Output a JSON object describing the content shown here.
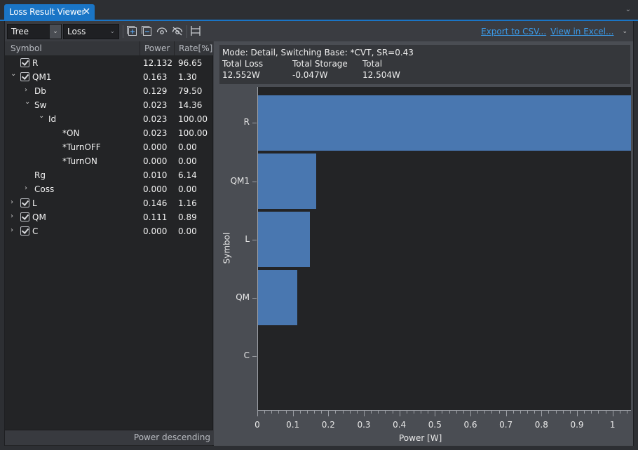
{
  "tab": {
    "title": "Loss Result Viewer",
    "close_glyph": "✕"
  },
  "toolbar": {
    "view_select": "Tree",
    "type_select": "Loss",
    "icons": [
      "expand-all-icon",
      "collapse-all-icon",
      "show-icon",
      "hide-icon",
      "fit-columns-icon"
    ],
    "export_csv": "Export to CSV...",
    "view_excel": "View in Excel..."
  },
  "tree": {
    "columns": [
      "Symbol",
      "Power",
      "Rate[%]"
    ],
    "rows": [
      {
        "label": "R",
        "power": "12.132",
        "rate": "96.65",
        "level": 0,
        "expander": "",
        "checkbox": true
      },
      {
        "label": "QM1",
        "power": "0.163",
        "rate": "1.30",
        "level": 0,
        "expander": "⌄",
        "checkbox": true
      },
      {
        "label": "Db",
        "power": "0.129",
        "rate": "79.50",
        "level": 1,
        "expander": "›",
        "checkbox": false
      },
      {
        "label": "Sw",
        "power": "0.023",
        "rate": "14.36",
        "level": 1,
        "expander": "⌄",
        "checkbox": false
      },
      {
        "label": "Id",
        "power": "0.023",
        "rate": "100.00",
        "level": 2,
        "expander": "⌄",
        "checkbox": false
      },
      {
        "label": "*ON",
        "power": "0.023",
        "rate": "100.00",
        "level": 3,
        "expander": "",
        "checkbox": false
      },
      {
        "label": "*TurnOFF",
        "power": "0.000",
        "rate": "0.00",
        "level": 3,
        "expander": "",
        "checkbox": false
      },
      {
        "label": "*TurnON",
        "power": "0.000",
        "rate": "0.00",
        "level": 3,
        "expander": "",
        "checkbox": false
      },
      {
        "label": "Rg",
        "power": "0.010",
        "rate": "6.14",
        "level": 1,
        "expander": "",
        "checkbox": false
      },
      {
        "label": "Coss",
        "power": "0.000",
        "rate": "0.00",
        "level": 1,
        "expander": "›",
        "checkbox": false
      },
      {
        "label": "L",
        "power": "0.146",
        "rate": "1.16",
        "level": 0,
        "expander": "›",
        "checkbox": true
      },
      {
        "label": "QM",
        "power": "0.111",
        "rate": "0.89",
        "level": 0,
        "expander": "›",
        "checkbox": true
      },
      {
        "label": "C",
        "power": "0.000",
        "rate": "0.00",
        "level": 0,
        "expander": "›",
        "checkbox": true
      }
    ],
    "status": "Power descending"
  },
  "summary": {
    "mode_line": "Mode: Detail, Switching Base: *CVT, SR=0.43",
    "total_loss_label": "Total Loss",
    "total_storage_label": "Total Storage",
    "total_label": "Total",
    "total_loss": "12.552W",
    "total_storage": "-0.047W",
    "total": "12.504W"
  },
  "chart_data": {
    "type": "bar",
    "orientation": "horizontal",
    "categories": [
      "R",
      "QM1",
      "L",
      "QM",
      "C"
    ],
    "values": [
      12.132,
      0.163,
      0.146,
      0.111,
      0.0
    ],
    "xlabel": "Power [W]",
    "ylabel": "Symbol",
    "xlim": [
      0,
      1.05
    ],
    "xticks": [
      "0",
      "0.1",
      "0.2",
      "0.3",
      "0.4",
      "0.5",
      "0.6",
      "0.7",
      "0.8",
      "0.9",
      "1"
    ],
    "bar_color": "#4977b0",
    "grid": false
  },
  "colors": {
    "accent": "#1a75c6",
    "link": "#3a9bea",
    "bar": "#4977b0"
  }
}
